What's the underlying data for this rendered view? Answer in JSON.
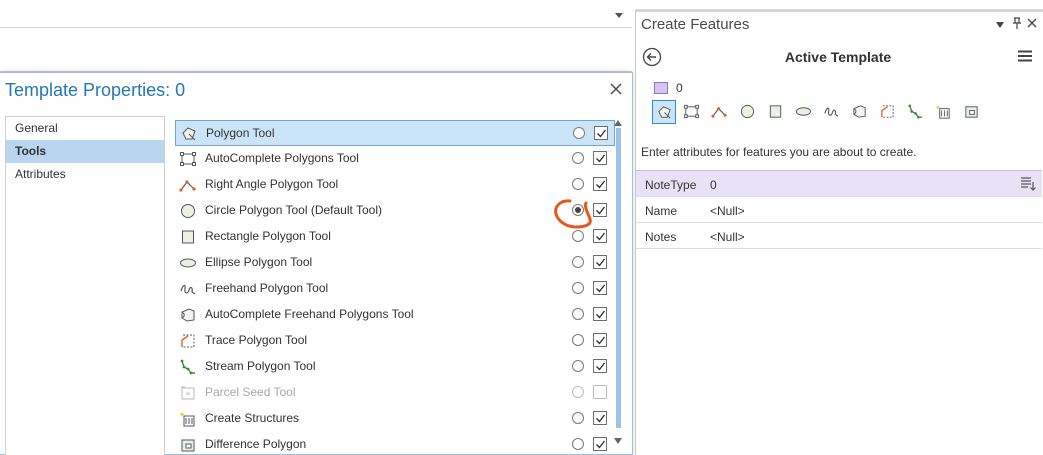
{
  "dialog": {
    "title": "Template Properties: 0",
    "nav": [
      {
        "label": "General",
        "selected": false
      },
      {
        "label": "Tools",
        "selected": true
      },
      {
        "label": "Attributes",
        "selected": false
      }
    ],
    "tools": [
      {
        "label": "Polygon Tool",
        "icon": "polygon-icon",
        "default": false,
        "enabled": true,
        "selected": true,
        "disabled": false
      },
      {
        "label": "AutoComplete Polygons Tool",
        "icon": "autocomplete-polygon-icon",
        "default": false,
        "enabled": true,
        "selected": false,
        "disabled": false
      },
      {
        "label": "Right Angle Polygon Tool",
        "icon": "right-angle-icon",
        "default": false,
        "enabled": true,
        "selected": false,
        "disabled": false
      },
      {
        "label": "Circle Polygon Tool  (Default Tool)",
        "icon": "circle-icon",
        "default": true,
        "enabled": true,
        "selected": false,
        "disabled": false
      },
      {
        "label": "Rectangle Polygon Tool",
        "icon": "rectangle-icon",
        "default": false,
        "enabled": true,
        "selected": false,
        "disabled": false
      },
      {
        "label": "Ellipse Polygon Tool",
        "icon": "ellipse-icon",
        "default": false,
        "enabled": true,
        "selected": false,
        "disabled": false
      },
      {
        "label": "Freehand Polygon Tool",
        "icon": "freehand-icon",
        "default": false,
        "enabled": true,
        "selected": false,
        "disabled": false
      },
      {
        "label": "AutoComplete Freehand Polygons Tool",
        "icon": "autocomplete-freehand-icon",
        "default": false,
        "enabled": true,
        "selected": false,
        "disabled": false
      },
      {
        "label": "Trace Polygon Tool",
        "icon": "trace-icon",
        "default": false,
        "enabled": true,
        "selected": false,
        "disabled": false
      },
      {
        "label": "Stream Polygon Tool",
        "icon": "stream-icon",
        "default": false,
        "enabled": true,
        "selected": false,
        "disabled": false
      },
      {
        "label": "Parcel Seed Tool",
        "icon": "parcel-seed-icon",
        "default": false,
        "enabled": false,
        "selected": false,
        "disabled": true
      },
      {
        "label": "Create Structures",
        "icon": "create-structures-icon",
        "default": false,
        "enabled": true,
        "selected": false,
        "disabled": false
      },
      {
        "label": "Difference Polygon",
        "icon": "difference-polygon-icon",
        "default": false,
        "enabled": true,
        "selected": false,
        "disabled": false
      }
    ]
  },
  "create_features": {
    "title": "Create Features",
    "heading": "Active Template",
    "template_name": "0",
    "swatch_color": "#d7c2f2",
    "instruction": "Enter attributes for features you are about to create.",
    "tool_icons": [
      "polygon-icon",
      "autocomplete-polygon-icon",
      "right-angle-icon",
      "circle-icon",
      "rectangle-icon",
      "ellipse-icon",
      "freehand-icon",
      "autocomplete-freehand-icon",
      "trace-icon",
      "stream-icon",
      "create-structures-icon",
      "difference-polygon-icon"
    ],
    "attributes": [
      {
        "name": "NoteType",
        "value": "0",
        "header": true
      },
      {
        "name": "Name",
        "value": "<Null>",
        "header": false
      },
      {
        "name": "Notes",
        "value": "<Null>",
        "header": false
      }
    ]
  },
  "colors": {
    "accent": "#2376b8",
    "selection": "#cce4f7",
    "annotation": "#e8561c"
  }
}
